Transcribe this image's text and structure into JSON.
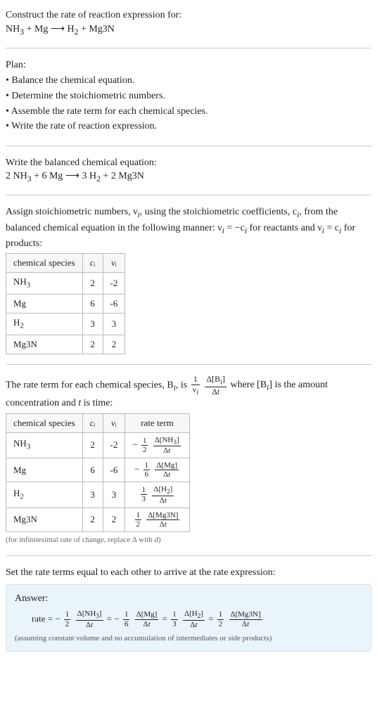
{
  "header": {
    "prompt": "Construct the rate of reaction expression for:",
    "equation_html": "NH<sub>3</sub> + Mg ⟶ H<sub>2</sub> + Mg3N"
  },
  "plan": {
    "title": "Plan:",
    "items": [
      "• Balance the chemical equation.",
      "• Determine the stoichiometric numbers.",
      "• Assemble the rate term for each chemical species.",
      "• Write the rate of reaction expression."
    ]
  },
  "balanced": {
    "intro": "Write the balanced chemical equation:",
    "equation_html": "2 NH<sub>3</sub> + 6 Mg ⟶ 3 H<sub>2</sub> + 2 Mg3N"
  },
  "stoich": {
    "intro_html": "Assign stoichiometric numbers, ν<sub><i>i</i></sub>, using the stoichiometric coefficients, c<sub><i>i</i></sub>, from the balanced chemical equation in the following manner: ν<sub><i>i</i></sub> = −c<sub><i>i</i></sub> for reactants and ν<sub><i>i</i></sub> = c<sub><i>i</i></sub> for products:",
    "headers": {
      "species": "chemical species",
      "c": "cᵢ",
      "nu": "νᵢ"
    },
    "rows": [
      {
        "species_html": "NH<sub>3</sub>",
        "c": "2",
        "nu": "-2"
      },
      {
        "species_html": "Mg",
        "c": "6",
        "nu": "-6"
      },
      {
        "species_html": "H<sub>2</sub>",
        "c": "3",
        "nu": "3"
      },
      {
        "species_html": "Mg3N",
        "c": "2",
        "nu": "2"
      }
    ]
  },
  "rateterm": {
    "intro_pre": "The rate term for each chemical species, B",
    "intro_mid": ", is ",
    "intro_post_html": " where [B<sub><i>i</i></sub>] is the amount concentration and <i>t</i> is time:",
    "headers": {
      "species": "chemical species",
      "c": "cᵢ",
      "nu": "νᵢ",
      "term": "rate term"
    },
    "rows": [
      {
        "species_html": "NH<sub>3</sub>",
        "c": "2",
        "nu": "-2",
        "sign": "−",
        "fnum": "1",
        "fden": "2",
        "dnum_html": "Δ[NH<sub>3</sub>]",
        "dden_html": "Δ<i>t</i>"
      },
      {
        "species_html": "Mg",
        "c": "6",
        "nu": "-6",
        "sign": "−",
        "fnum": "1",
        "fden": "6",
        "dnum_html": "Δ[Mg]",
        "dden_html": "Δ<i>t</i>"
      },
      {
        "species_html": "H<sub>2</sub>",
        "c": "3",
        "nu": "3",
        "sign": "",
        "fnum": "1",
        "fden": "3",
        "dnum_html": "Δ[H<sub>2</sub>]",
        "dden_html": "Δ<i>t</i>"
      },
      {
        "species_html": "Mg3N",
        "c": "2",
        "nu": "2",
        "sign": "",
        "fnum": "1",
        "fden": "2",
        "dnum_html": "Δ[Mg3N]",
        "dden_html": "Δ<i>t</i>"
      }
    ],
    "footnote_html": "(for infinitesimal rate of change, replace Δ with <i>d</i>)"
  },
  "final": {
    "intro": "Set the rate terms equal to each other to arrive at the rate expression:",
    "answer_label": "Answer:",
    "rate_prefix": "rate = ",
    "terms": [
      {
        "sign": "−",
        "fnum": "1",
        "fden": "2",
        "dnum_html": "Δ[NH<sub>3</sub>]",
        "dden_html": "Δ<i>t</i>"
      },
      {
        "sign": "−",
        "fnum": "1",
        "fden": "6",
        "dnum_html": "Δ[Mg]",
        "dden_html": "Δ<i>t</i>"
      },
      {
        "sign": "",
        "fnum": "1",
        "fden": "3",
        "dnum_html": "Δ[H<sub>2</sub>]",
        "dden_html": "Δ<i>t</i>"
      },
      {
        "sign": "",
        "fnum": "1",
        "fden": "2",
        "dnum_html": "Δ[Mg3N]",
        "dden_html": "Δ<i>t</i>"
      }
    ],
    "note": "(assuming constant volume and no accumulation of intermediates or side products)"
  },
  "math": {
    "one": "1",
    "nu_i_html": "ν<sub><i>i</i></sub>",
    "dBi_html": "Δ[B<sub><i>i</i></sub>]",
    "dt_html": "Δ<i>t</i>",
    "i_sub": "i",
    "eq": " = "
  }
}
